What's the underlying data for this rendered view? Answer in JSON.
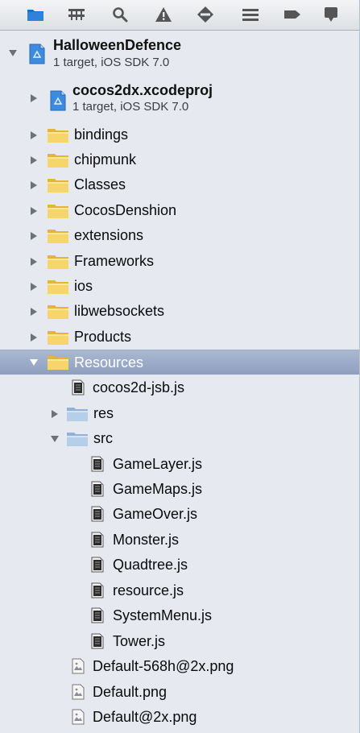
{
  "toolbar": {
    "icons": [
      "folder-icon",
      "symbol-hierarchy-icon",
      "search-icon",
      "warning-icon",
      "test-diamond-icon",
      "debug-list-icon",
      "breakpoint-tag-icon",
      "log-bubble-icon"
    ],
    "selected_color": "#1a6fc7"
  },
  "tree": {
    "project": {
      "name": "HalloweenDefence",
      "subtitle": "1 target, iOS SDK 7.0"
    },
    "subproject": {
      "name": "cocos2dx.xcodeproj",
      "subtitle": "1 target, iOS SDK 7.0"
    },
    "groups": {
      "bindings": "bindings",
      "chipmunk": "chipmunk",
      "classes": "Classes",
      "cocosdenshion": "CocosDenshion",
      "extensions": "extensions",
      "frameworks": "Frameworks",
      "ios": "ios",
      "libwebsockets": "libwebsockets",
      "products": "Products",
      "resources": "Resources"
    },
    "resources": {
      "jsb_file": "cocos2d-jsb.js",
      "res_folder": "res",
      "src_folder": "src",
      "src_files": [
        "GameLayer.js",
        "GameMaps.js",
        "GameOver.js",
        "Monster.js",
        "Quadtree.js",
        "resource.js",
        "SystemMenu.js",
        "Tower.js"
      ]
    },
    "images": [
      "Default-568h@2x.png",
      "Default.png",
      "Default@2x.png"
    ],
    "selection_color": "#8e9fbf"
  }
}
